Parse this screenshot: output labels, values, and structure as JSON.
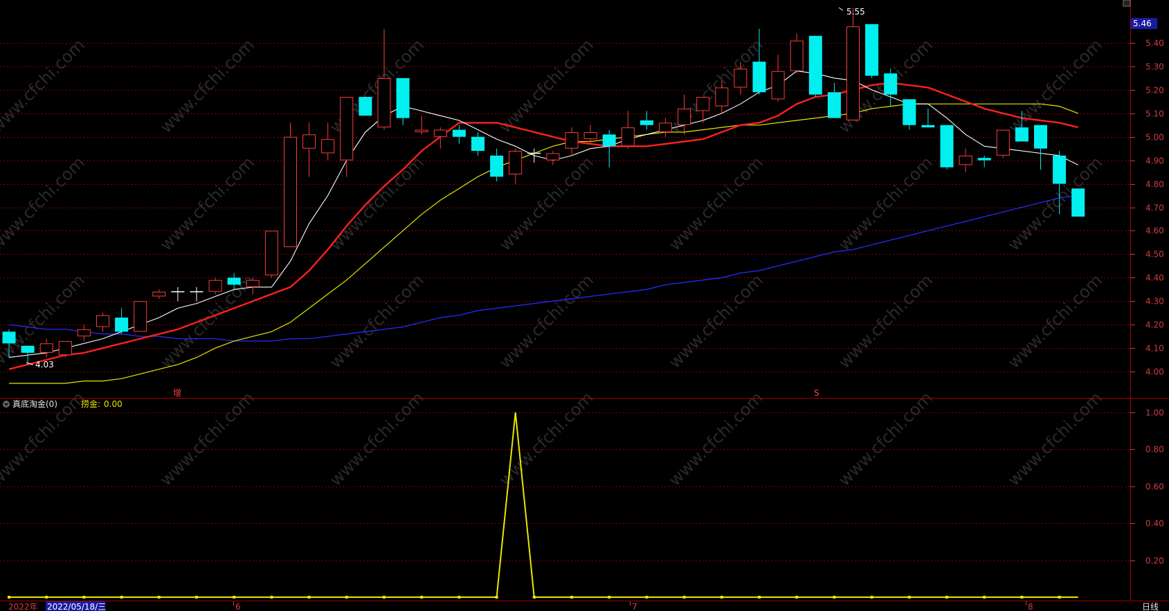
{
  "header": {
    "text": ""
  },
  "price_badge": "5.46",
  "indicator": {
    "name": "真底淘金(0)",
    "line_label": "捞金:",
    "line_value": "0.00"
  },
  "markers": {
    "zeng": "增",
    "s": "S"
  },
  "bottom": {
    "year": "2022年",
    "date": "2022/05/18/三",
    "m6": "6",
    "m7": "7",
    "m8": "8",
    "period": "日线"
  },
  "annotations": {
    "high": "5.55",
    "low": "4.03"
  },
  "watermark": "www.cfchi.com",
  "colors": {
    "up": "#ff3b3b",
    "down": "#00f0f0",
    "ma5": "#ffffff",
    "ma10": "#ff2020",
    "ma20": "#e8e800",
    "ma60": "#2a2aff",
    "grid": "#8b0000",
    "axis": "#d23c3c"
  },
  "chart_data": [
    {
      "type": "candlestick",
      "ylim": [
        3.9,
        5.55
      ],
      "yticks": [
        5.4,
        5.3,
        5.2,
        5.1,
        5.0,
        4.9,
        4.8,
        4.7,
        4.6,
        4.5,
        4.4,
        4.3,
        4.2,
        4.1,
        4.0
      ],
      "candles": [
        [
          4.17,
          4.18,
          4.06,
          4.12
        ],
        [
          4.11,
          4.11,
          4.03,
          4.08
        ],
        [
          4.08,
          4.14,
          4.06,
          4.12
        ],
        [
          4.07,
          4.13,
          4.06,
          4.13
        ],
        [
          4.15,
          4.2,
          4.13,
          4.18
        ],
        [
          4.19,
          4.25,
          4.17,
          4.24
        ],
        [
          4.23,
          4.27,
          4.16,
          4.17
        ],
        [
          4.17,
          4.3,
          4.17,
          4.3
        ],
        [
          4.32,
          4.35,
          4.31,
          4.34
        ],
        [
          4.34,
          4.36,
          4.3,
          4.34
        ],
        [
          4.34,
          4.36,
          4.3,
          4.34
        ],
        [
          4.34,
          4.4,
          4.33,
          4.39
        ],
        [
          4.4,
          4.42,
          4.35,
          4.37
        ],
        [
          4.36,
          4.4,
          4.33,
          4.39
        ],
        [
          4.41,
          4.6,
          4.4,
          4.6
        ],
        [
          4.53,
          5.06,
          4.53,
          5.0
        ],
        [
          4.95,
          5.06,
          4.83,
          5.01
        ],
        [
          4.93,
          5.06,
          4.9,
          4.99
        ],
        [
          4.9,
          5.16,
          4.83,
          5.17
        ],
        [
          5.17,
          5.17,
          5.09,
          5.09
        ],
        [
          5.04,
          5.46,
          5.03,
          5.25
        ],
        [
          5.25,
          5.25,
          5.05,
          5.08
        ],
        [
          5.02,
          5.09,
          5.01,
          5.03
        ],
        [
          5.0,
          5.04,
          4.95,
          5.03
        ],
        [
          5.03,
          5.05,
          4.97,
          5.0
        ],
        [
          5.0,
          5.02,
          4.92,
          4.94
        ],
        [
          4.92,
          4.95,
          4.81,
          4.83
        ],
        [
          4.84,
          4.95,
          4.8,
          4.94
        ],
        [
          4.93,
          4.95,
          4.89,
          4.93
        ],
        [
          4.9,
          4.94,
          4.88,
          4.93
        ],
        [
          4.95,
          5.04,
          4.92,
          5.02
        ],
        [
          4.99,
          5.05,
          4.97,
          5.02
        ],
        [
          5.01,
          5.03,
          4.87,
          4.96
        ],
        [
          4.96,
          5.11,
          4.95,
          5.04
        ],
        [
          5.07,
          5.11,
          5.03,
          5.05
        ],
        [
          5.02,
          5.08,
          5.0,
          5.06
        ],
        [
          5.05,
          5.18,
          5.01,
          5.12
        ],
        [
          5.11,
          5.17,
          5.06,
          5.17
        ],
        [
          5.13,
          5.24,
          5.1,
          5.21
        ],
        [
          5.21,
          5.32,
          5.18,
          5.29
        ],
        [
          5.32,
          5.46,
          5.18,
          5.19
        ],
        [
          5.16,
          5.35,
          5.15,
          5.28
        ],
        [
          5.28,
          5.44,
          5.27,
          5.41
        ],
        [
          5.43,
          5.43,
          5.17,
          5.18
        ],
        [
          5.19,
          5.23,
          5.08,
          5.08
        ],
        [
          5.07,
          5.55,
          5.07,
          5.47
        ],
        [
          5.48,
          5.48,
          5.25,
          5.26
        ],
        [
          5.27,
          5.29,
          5.13,
          5.18
        ],
        [
          5.16,
          5.16,
          5.03,
          5.05
        ],
        [
          5.05,
          5.12,
          5.04,
          5.04
        ],
        [
          5.05,
          5.05,
          4.86,
          4.87
        ],
        [
          4.88,
          4.95,
          4.85,
          4.92
        ],
        [
          4.91,
          4.92,
          4.87,
          4.9
        ],
        [
          4.92,
          5.03,
          4.91,
          5.03
        ],
        [
          5.04,
          5.11,
          4.98,
          4.98
        ],
        [
          5.05,
          5.05,
          4.86,
          4.95
        ],
        [
          4.92,
          4.94,
          4.67,
          4.8
        ],
        [
          4.78,
          4.78,
          4.66,
          4.66
        ]
      ],
      "ma5": [
        4.06,
        4.07,
        4.08,
        4.1,
        4.12,
        4.14,
        4.17,
        4.2,
        4.23,
        4.27,
        4.29,
        4.32,
        4.35,
        4.36,
        4.36,
        4.47,
        4.63,
        4.75,
        4.9,
        5.02,
        5.09,
        5.13,
        5.11,
        5.09,
        5.07,
        5.03,
        4.99,
        4.96,
        4.92,
        4.9,
        4.92,
        4.95,
        4.96,
        4.99,
        5.01,
        5.03,
        5.05,
        5.07,
        5.1,
        5.14,
        5.19,
        5.22,
        5.28,
        5.27,
        5.25,
        5.24,
        5.2,
        5.17,
        5.14,
        5.14,
        5.08,
        5.01,
        4.96,
        4.95,
        4.94,
        4.93,
        4.92,
        4.88
      ],
      "ma10": [
        4.01,
        4.03,
        4.05,
        4.07,
        4.08,
        4.1,
        4.12,
        4.14,
        4.16,
        4.18,
        4.21,
        4.24,
        4.27,
        4.3,
        4.33,
        4.36,
        4.43,
        4.52,
        4.62,
        4.71,
        4.79,
        4.86,
        4.94,
        5.0,
        5.06,
        5.06,
        5.06,
        5.04,
        5.02,
        5.0,
        4.98,
        4.97,
        4.96,
        4.96,
        4.96,
        4.97,
        4.98,
        4.99,
        5.02,
        5.05,
        5.06,
        5.09,
        5.14,
        5.17,
        5.18,
        5.2,
        5.22,
        5.23,
        5.22,
        5.21,
        5.18,
        5.15,
        5.12,
        5.1,
        5.08,
        5.07,
        5.06,
        5.04
      ],
      "ma20": [
        3.95,
        3.95,
        3.95,
        3.95,
        3.96,
        3.96,
        3.97,
        3.99,
        4.01,
        4.03,
        4.06,
        4.1,
        4.13,
        4.15,
        4.17,
        4.21,
        4.27,
        4.33,
        4.39,
        4.46,
        4.53,
        4.6,
        4.67,
        4.73,
        4.78,
        4.83,
        4.87,
        4.9,
        4.93,
        4.96,
        4.98,
        4.98,
        4.99,
        5.0,
        5.01,
        5.02,
        5.02,
        5.03,
        5.04,
        5.05,
        5.05,
        5.06,
        5.07,
        5.08,
        5.09,
        5.1,
        5.12,
        5.13,
        5.14,
        5.14,
        5.14,
        5.14,
        5.14,
        5.14,
        5.14,
        5.14,
        5.13,
        5.1
      ],
      "ma60": [
        4.2,
        4.19,
        4.18,
        4.18,
        4.17,
        4.16,
        4.16,
        4.15,
        4.15,
        4.14,
        4.14,
        4.14,
        4.13,
        4.13,
        4.13,
        4.14,
        4.14,
        4.15,
        4.16,
        4.17,
        4.18,
        4.19,
        4.21,
        4.23,
        4.24,
        4.26,
        4.27,
        4.28,
        4.29,
        4.3,
        4.31,
        4.32,
        4.33,
        4.34,
        4.35,
        4.37,
        4.38,
        4.39,
        4.4,
        4.42,
        4.43,
        4.45,
        4.47,
        4.49,
        4.51,
        4.52,
        4.54,
        4.56,
        4.58,
        4.6,
        4.62,
        4.64,
        4.66,
        4.68,
        4.7,
        4.72,
        4.74,
        4.75
      ]
    },
    {
      "type": "line",
      "series": [
        {
          "name": "捞金",
          "values": [
            0,
            0,
            0,
            0,
            0,
            0,
            0,
            0,
            0,
            0,
            0,
            0,
            0,
            0,
            0,
            0,
            0,
            0,
            0,
            0,
            0,
            0,
            0,
            0,
            0,
            0,
            0,
            1,
            0,
            0,
            0,
            0,
            0,
            0,
            0,
            0,
            0,
            0,
            0,
            0,
            0,
            0,
            0,
            0,
            0,
            0,
            0,
            0,
            0,
            0,
            0,
            0,
            0,
            0,
            0,
            0,
            0,
            0
          ]
        }
      ],
      "ylim": [
        0,
        1.0
      ],
      "yticks": [
        1.0,
        0.8,
        0.6,
        0.4,
        0.2
      ]
    }
  ]
}
